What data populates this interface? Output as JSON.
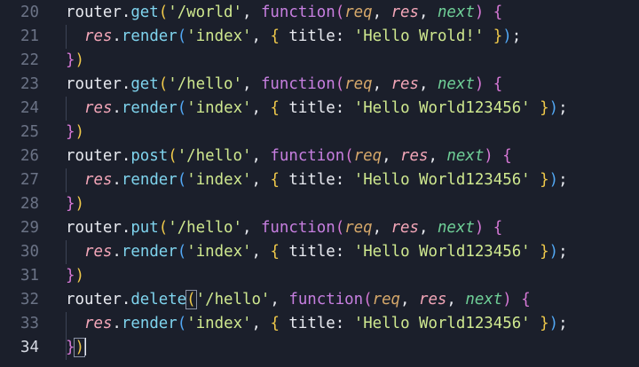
{
  "editor": {
    "lines": [
      {
        "n": "20",
        "indent": 0,
        "tokens": [
          [
            "router",
            "plain"
          ],
          [
            ".",
            "plain"
          ],
          [
            "get",
            "method"
          ],
          [
            "(",
            "p1"
          ],
          [
            "'/world'",
            "str"
          ],
          [
            ", ",
            "plain"
          ],
          [
            "function",
            "kw"
          ],
          [
            "(",
            "p2"
          ],
          [
            "req",
            "req"
          ],
          [
            ", ",
            "plain"
          ],
          [
            "res",
            "res"
          ],
          [
            ", ",
            "plain"
          ],
          [
            "next",
            "next"
          ],
          [
            ")",
            "p2"
          ],
          [
            " ",
            "plain"
          ],
          [
            "{",
            "p2"
          ]
        ]
      },
      {
        "n": "21",
        "indent": 1,
        "tokens": [
          [
            "res",
            "var"
          ],
          [
            ".",
            "plain"
          ],
          [
            "render",
            "method"
          ],
          [
            "(",
            "p3"
          ],
          [
            "'index'",
            "str"
          ],
          [
            ", ",
            "plain"
          ],
          [
            "{",
            "p1"
          ],
          [
            " title: ",
            "prop"
          ],
          [
            "'Hello Wrold!'",
            "str"
          ],
          [
            " ",
            "plain"
          ],
          [
            "}",
            "p1"
          ],
          [
            ")",
            "p3"
          ],
          [
            ";",
            "plain"
          ]
        ]
      },
      {
        "n": "22",
        "indent": 0,
        "tokens": [
          [
            "}",
            "p2"
          ],
          [
            ")",
            "p1"
          ]
        ]
      },
      {
        "n": "23",
        "indent": 0,
        "tokens": [
          [
            "router",
            "plain"
          ],
          [
            ".",
            "plain"
          ],
          [
            "get",
            "method"
          ],
          [
            "(",
            "p1"
          ],
          [
            "'/hello'",
            "str"
          ],
          [
            ", ",
            "plain"
          ],
          [
            "function",
            "kw"
          ],
          [
            "(",
            "p2"
          ],
          [
            "req",
            "req"
          ],
          [
            ", ",
            "plain"
          ],
          [
            "res",
            "res"
          ],
          [
            ", ",
            "plain"
          ],
          [
            "next",
            "next"
          ],
          [
            ")",
            "p2"
          ],
          [
            " ",
            "plain"
          ],
          [
            "{",
            "p2"
          ]
        ]
      },
      {
        "n": "24",
        "indent": 1,
        "tokens": [
          [
            "res",
            "var"
          ],
          [
            ".",
            "plain"
          ],
          [
            "render",
            "method"
          ],
          [
            "(",
            "p3"
          ],
          [
            "'index'",
            "str"
          ],
          [
            ", ",
            "plain"
          ],
          [
            "{",
            "p1"
          ],
          [
            " title: ",
            "prop"
          ],
          [
            "'Hello World123456'",
            "str"
          ],
          [
            " ",
            "plain"
          ],
          [
            "}",
            "p1"
          ],
          [
            ")",
            "p3"
          ],
          [
            ";",
            "plain"
          ]
        ]
      },
      {
        "n": "25",
        "indent": 0,
        "tokens": [
          [
            "}",
            "p2"
          ],
          [
            ")",
            "p1"
          ]
        ]
      },
      {
        "n": "26",
        "indent": 0,
        "tokens": [
          [
            "router",
            "plain"
          ],
          [
            ".",
            "plain"
          ],
          [
            "post",
            "method"
          ],
          [
            "(",
            "p1"
          ],
          [
            "'/hello'",
            "str"
          ],
          [
            ", ",
            "plain"
          ],
          [
            "function",
            "kw"
          ],
          [
            "(",
            "p2"
          ],
          [
            "req",
            "req"
          ],
          [
            ", ",
            "plain"
          ],
          [
            "res",
            "res"
          ],
          [
            ", ",
            "plain"
          ],
          [
            "next",
            "next"
          ],
          [
            ")",
            "p2"
          ],
          [
            " ",
            "plain"
          ],
          [
            "{",
            "p2"
          ]
        ]
      },
      {
        "n": "27",
        "indent": 1,
        "tokens": [
          [
            "res",
            "var"
          ],
          [
            ".",
            "plain"
          ],
          [
            "render",
            "method"
          ],
          [
            "(",
            "p3"
          ],
          [
            "'index'",
            "str"
          ],
          [
            ", ",
            "plain"
          ],
          [
            "{",
            "p1"
          ],
          [
            " title: ",
            "prop"
          ],
          [
            "'Hello World123456'",
            "str"
          ],
          [
            " ",
            "plain"
          ],
          [
            "}",
            "p1"
          ],
          [
            ")",
            "p3"
          ],
          [
            ";",
            "plain"
          ]
        ]
      },
      {
        "n": "28",
        "indent": 0,
        "tokens": [
          [
            "}",
            "p2"
          ],
          [
            ")",
            "p1"
          ]
        ]
      },
      {
        "n": "29",
        "indent": 0,
        "tokens": [
          [
            "router",
            "plain"
          ],
          [
            ".",
            "plain"
          ],
          [
            "put",
            "method"
          ],
          [
            "(",
            "p1"
          ],
          [
            "'/hello'",
            "str"
          ],
          [
            ", ",
            "plain"
          ],
          [
            "function",
            "kw"
          ],
          [
            "(",
            "p2"
          ],
          [
            "req",
            "req"
          ],
          [
            ", ",
            "plain"
          ],
          [
            "res",
            "res"
          ],
          [
            ", ",
            "plain"
          ],
          [
            "next",
            "next"
          ],
          [
            ")",
            "p2"
          ],
          [
            " ",
            "plain"
          ],
          [
            "{",
            "p2"
          ]
        ]
      },
      {
        "n": "30",
        "indent": 1,
        "tokens": [
          [
            "res",
            "var"
          ],
          [
            ".",
            "plain"
          ],
          [
            "render",
            "method"
          ],
          [
            "(",
            "p3"
          ],
          [
            "'index'",
            "str"
          ],
          [
            ", ",
            "plain"
          ],
          [
            "{",
            "p1"
          ],
          [
            " title: ",
            "prop"
          ],
          [
            "'Hello World123456'",
            "str"
          ],
          [
            " ",
            "plain"
          ],
          [
            "}",
            "p1"
          ],
          [
            ")",
            "p3"
          ],
          [
            ";",
            "plain"
          ]
        ]
      },
      {
        "n": "31",
        "indent": 0,
        "tokens": [
          [
            "}",
            "p2"
          ],
          [
            ")",
            "p1"
          ]
        ]
      },
      {
        "n": "32",
        "indent": 0,
        "tokens": [
          [
            "router",
            "plain"
          ],
          [
            ".",
            "plain"
          ],
          [
            "delete",
            "method"
          ],
          [
            "(",
            "p1-match"
          ],
          [
            "'/hello'",
            "str"
          ],
          [
            ", ",
            "plain"
          ],
          [
            "function",
            "kw"
          ],
          [
            "(",
            "p2"
          ],
          [
            "req",
            "req"
          ],
          [
            ", ",
            "plain"
          ],
          [
            "res",
            "res"
          ],
          [
            ", ",
            "plain"
          ],
          [
            "next",
            "next"
          ],
          [
            ")",
            "p2"
          ],
          [
            " ",
            "plain"
          ],
          [
            "{",
            "p2"
          ]
        ]
      },
      {
        "n": "33",
        "indent": 1,
        "tokens": [
          [
            "res",
            "var"
          ],
          [
            ".",
            "plain"
          ],
          [
            "render",
            "method"
          ],
          [
            "(",
            "p3"
          ],
          [
            "'index'",
            "str"
          ],
          [
            ", ",
            "plain"
          ],
          [
            "{",
            "p1"
          ],
          [
            " title: ",
            "prop"
          ],
          [
            "'Hello World123456'",
            "str"
          ],
          [
            " ",
            "plain"
          ],
          [
            "}",
            "p1"
          ],
          [
            ")",
            "p3"
          ],
          [
            ";",
            "plain"
          ]
        ]
      },
      {
        "n": "34",
        "indent": 0,
        "current": true,
        "tokens": [
          [
            "}",
            "p2"
          ],
          [
            ")",
            "p1-match"
          ],
          [
            "",
            "cursor"
          ]
        ]
      }
    ]
  },
  "colors": {
    "background": "#1b1f2b",
    "keyword": "#c77fe0",
    "string": "#cfe88f",
    "method": "#7fd4ee",
    "variable": "#f3a6b8"
  }
}
